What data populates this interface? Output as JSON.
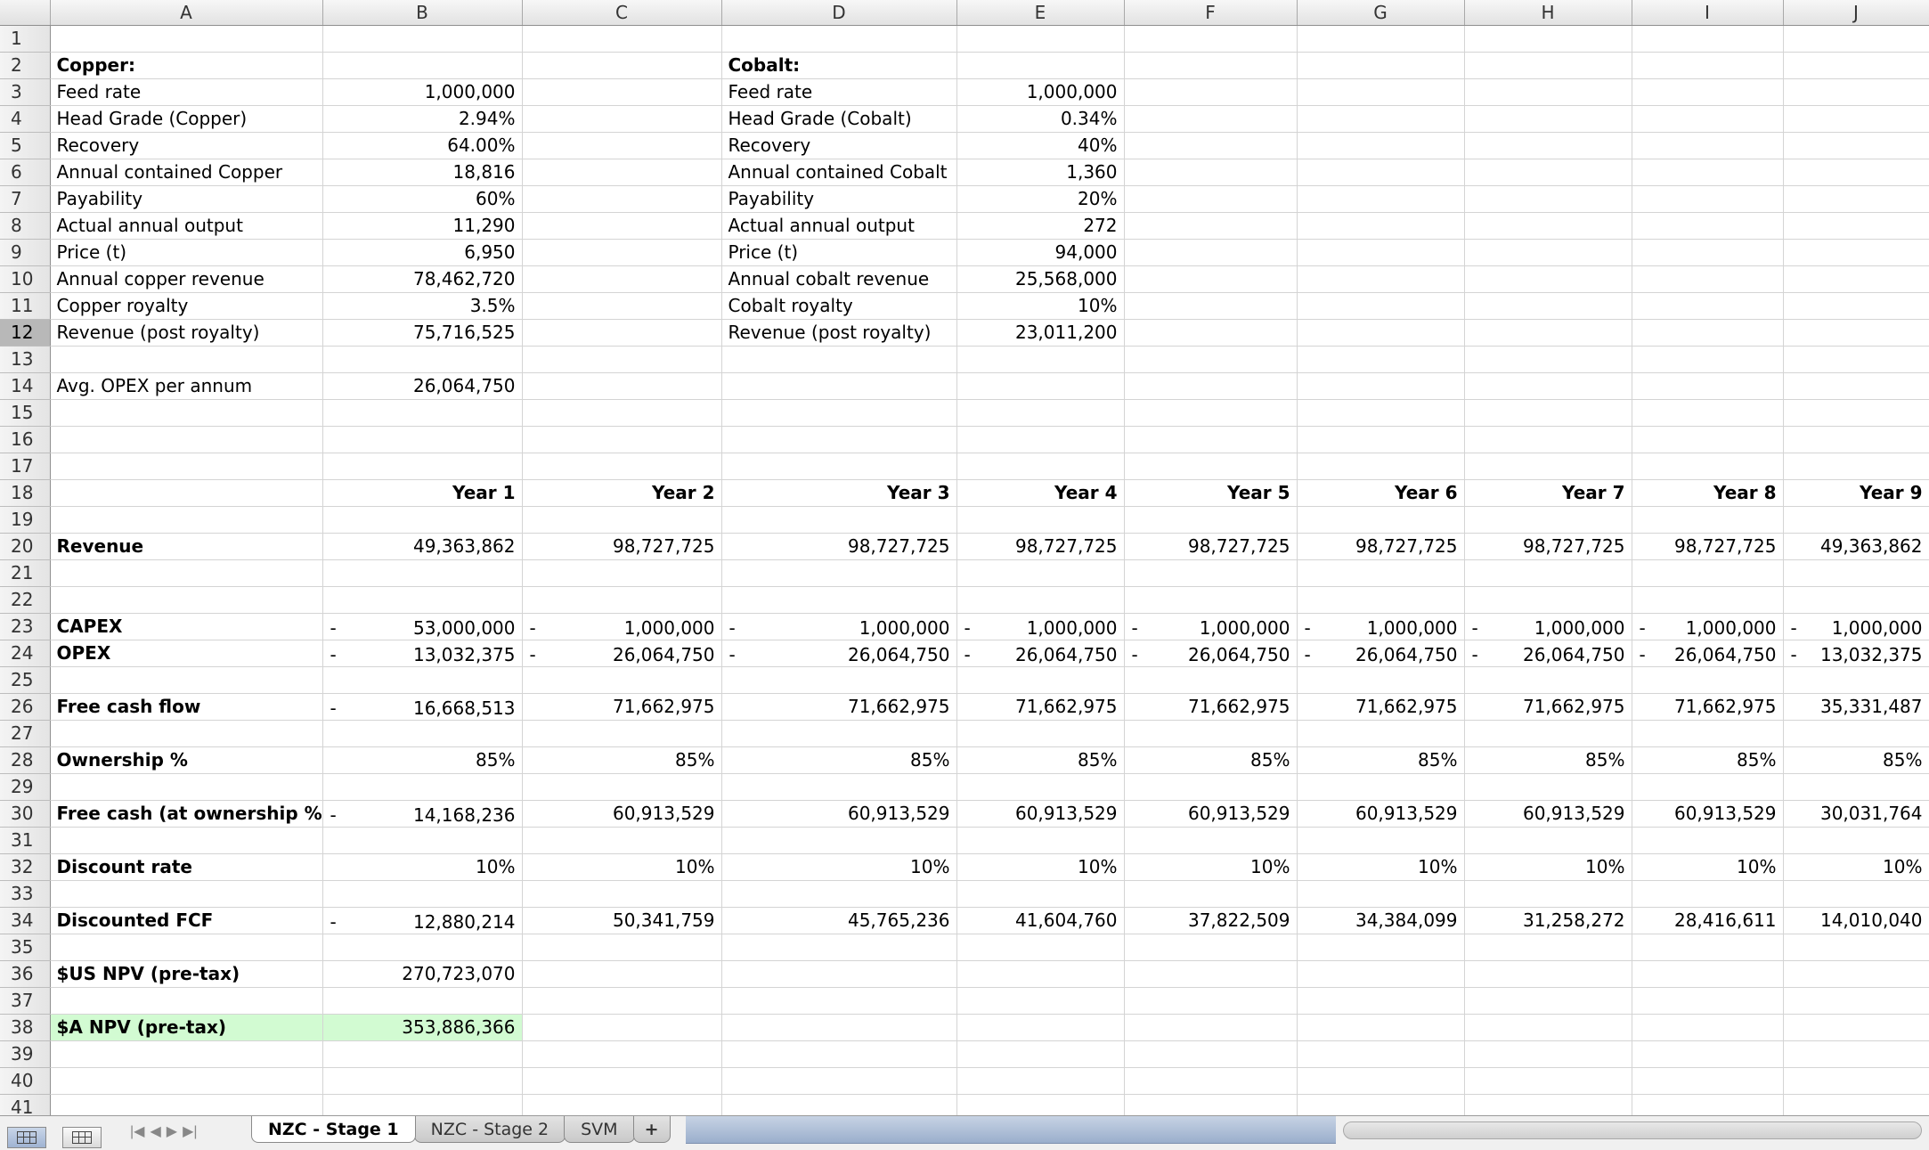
{
  "columns": [
    "A",
    "B",
    "C",
    "D",
    "E",
    "F",
    "G",
    "H",
    "I",
    "J"
  ],
  "selected_row": 12,
  "rows": [
    {
      "n": 1,
      "cells": []
    },
    {
      "n": 2,
      "cells": [
        {
          "c": 0,
          "v": "Copper:",
          "b": true
        },
        {
          "c": 3,
          "v": "Cobalt:",
          "b": true
        }
      ]
    },
    {
      "n": 3,
      "cells": [
        {
          "c": 0,
          "v": "Feed rate"
        },
        {
          "c": 1,
          "v": "1,000,000",
          "r": true
        },
        {
          "c": 3,
          "v": "Feed rate"
        },
        {
          "c": 4,
          "v": "1,000,000",
          "r": true
        }
      ]
    },
    {
      "n": 4,
      "cells": [
        {
          "c": 0,
          "v": "Head Grade (Copper)"
        },
        {
          "c": 1,
          "v": "2.94%",
          "r": true
        },
        {
          "c": 3,
          "v": "Head Grade (Cobalt)"
        },
        {
          "c": 4,
          "v": "0.34%",
          "r": true
        }
      ]
    },
    {
      "n": 5,
      "cells": [
        {
          "c": 0,
          "v": "Recovery"
        },
        {
          "c": 1,
          "v": "64.00%",
          "r": true
        },
        {
          "c": 3,
          "v": "Recovery"
        },
        {
          "c": 4,
          "v": "40%",
          "r": true
        }
      ]
    },
    {
      "n": 6,
      "cells": [
        {
          "c": 0,
          "v": "Annual contained Copper"
        },
        {
          "c": 1,
          "v": "18,816",
          "r": true
        },
        {
          "c": 3,
          "v": "Annual contained Cobalt"
        },
        {
          "c": 4,
          "v": "1,360",
          "r": true
        }
      ]
    },
    {
      "n": 7,
      "cells": [
        {
          "c": 0,
          "v": "Payability"
        },
        {
          "c": 1,
          "v": "60%",
          "r": true
        },
        {
          "c": 3,
          "v": "Payability"
        },
        {
          "c": 4,
          "v": "20%",
          "r": true
        }
      ]
    },
    {
      "n": 8,
      "cells": [
        {
          "c": 0,
          "v": "Actual annual output"
        },
        {
          "c": 1,
          "v": "11,290",
          "r": true
        },
        {
          "c": 3,
          "v": "Actual annual output"
        },
        {
          "c": 4,
          "v": "272",
          "r": true
        }
      ]
    },
    {
      "n": 9,
      "cells": [
        {
          "c": 0,
          "v": "Price (t)"
        },
        {
          "c": 1,
          "v": "6,950",
          "r": true
        },
        {
          "c": 3,
          "v": "Price (t)"
        },
        {
          "c": 4,
          "v": "94,000",
          "r": true
        }
      ]
    },
    {
      "n": 10,
      "cells": [
        {
          "c": 0,
          "v": "Annual copper revenue"
        },
        {
          "c": 1,
          "v": "78,462,720",
          "r": true
        },
        {
          "c": 3,
          "v": "Annual cobalt revenue"
        },
        {
          "c": 4,
          "v": "25,568,000",
          "r": true
        }
      ]
    },
    {
      "n": 11,
      "cells": [
        {
          "c": 0,
          "v": "Copper royalty"
        },
        {
          "c": 1,
          "v": "3.5%",
          "r": true
        },
        {
          "c": 3,
          "v": "Cobalt royalty"
        },
        {
          "c": 4,
          "v": "10%",
          "r": true
        }
      ]
    },
    {
      "n": 12,
      "cells": [
        {
          "c": 0,
          "v": "Revenue (post royalty)"
        },
        {
          "c": 1,
          "v": "75,716,525",
          "r": true
        },
        {
          "c": 3,
          "v": "Revenue (post royalty)"
        },
        {
          "c": 4,
          "v": "23,011,200",
          "r": true
        }
      ]
    },
    {
      "n": 13,
      "cells": []
    },
    {
      "n": 14,
      "cells": [
        {
          "c": 0,
          "v": "Avg. OPEX per annum"
        },
        {
          "c": 1,
          "v": "26,064,750",
          "r": true
        }
      ]
    },
    {
      "n": 15,
      "cells": []
    },
    {
      "n": 16,
      "cells": []
    },
    {
      "n": 17,
      "cells": []
    },
    {
      "n": 18,
      "cells": [
        {
          "c": 1,
          "v": "Year 1",
          "r": true,
          "b": true
        },
        {
          "c": 2,
          "v": "Year 2",
          "r": true,
          "b": true
        },
        {
          "c": 3,
          "v": "Year 3",
          "r": true,
          "b": true
        },
        {
          "c": 4,
          "v": "Year 4",
          "r": true,
          "b": true
        },
        {
          "c": 5,
          "v": "Year 5",
          "r": true,
          "b": true
        },
        {
          "c": 6,
          "v": "Year 6",
          "r": true,
          "b": true
        },
        {
          "c": 7,
          "v": "Year 7",
          "r": true,
          "b": true
        },
        {
          "c": 8,
          "v": "Year 8",
          "r": true,
          "b": true
        },
        {
          "c": 9,
          "v": "Year 9",
          "r": true,
          "b": true
        }
      ]
    },
    {
      "n": 19,
      "cells": []
    },
    {
      "n": 20,
      "cells": [
        {
          "c": 0,
          "v": "Revenue",
          "b": true
        },
        {
          "c": 1,
          "v": "49,363,862",
          "r": true
        },
        {
          "c": 2,
          "v": "98,727,725",
          "r": true
        },
        {
          "c": 3,
          "v": "98,727,725",
          "r": true
        },
        {
          "c": 4,
          "v": "98,727,725",
          "r": true
        },
        {
          "c": 5,
          "v": "98,727,725",
          "r": true
        },
        {
          "c": 6,
          "v": "98,727,725",
          "r": true
        },
        {
          "c": 7,
          "v": "98,727,725",
          "r": true
        },
        {
          "c": 8,
          "v": "98,727,725",
          "r": true
        },
        {
          "c": 9,
          "v": "49,363,862",
          "r": true
        }
      ]
    },
    {
      "n": 21,
      "cells": []
    },
    {
      "n": 22,
      "cells": []
    },
    {
      "n": 23,
      "cells": [
        {
          "c": 0,
          "v": "CAPEX",
          "b": true
        },
        {
          "c": 1,
          "v": "53,000,000",
          "r": true,
          "neg": true
        },
        {
          "c": 2,
          "v": "1,000,000",
          "r": true,
          "neg": true
        },
        {
          "c": 3,
          "v": "1,000,000",
          "r": true,
          "neg": true
        },
        {
          "c": 4,
          "v": "1,000,000",
          "r": true,
          "neg": true
        },
        {
          "c": 5,
          "v": "1,000,000",
          "r": true,
          "neg": true
        },
        {
          "c": 6,
          "v": "1,000,000",
          "r": true,
          "neg": true
        },
        {
          "c": 7,
          "v": "1,000,000",
          "r": true,
          "neg": true
        },
        {
          "c": 8,
          "v": "1,000,000",
          "r": true,
          "neg": true
        },
        {
          "c": 9,
          "v": "1,000,000",
          "r": true,
          "neg": true
        }
      ]
    },
    {
      "n": 24,
      "cells": [
        {
          "c": 0,
          "v": "OPEX",
          "b": true
        },
        {
          "c": 1,
          "v": "13,032,375",
          "r": true,
          "neg": true
        },
        {
          "c": 2,
          "v": "26,064,750",
          "r": true,
          "neg": true
        },
        {
          "c": 3,
          "v": "26,064,750",
          "r": true,
          "neg": true
        },
        {
          "c": 4,
          "v": "26,064,750",
          "r": true,
          "neg": true
        },
        {
          "c": 5,
          "v": "26,064,750",
          "r": true,
          "neg": true
        },
        {
          "c": 6,
          "v": "26,064,750",
          "r": true,
          "neg": true
        },
        {
          "c": 7,
          "v": "26,064,750",
          "r": true,
          "neg": true
        },
        {
          "c": 8,
          "v": "26,064,750",
          "r": true,
          "neg": true
        },
        {
          "c": 9,
          "v": "13,032,375",
          "r": true,
          "neg": true
        }
      ]
    },
    {
      "n": 25,
      "cells": []
    },
    {
      "n": 26,
      "cells": [
        {
          "c": 0,
          "v": "Free cash flow",
          "b": true
        },
        {
          "c": 1,
          "v": "16,668,513",
          "r": true,
          "neg": true
        },
        {
          "c": 2,
          "v": "71,662,975",
          "r": true
        },
        {
          "c": 3,
          "v": "71,662,975",
          "r": true
        },
        {
          "c": 4,
          "v": "71,662,975",
          "r": true
        },
        {
          "c": 5,
          "v": "71,662,975",
          "r": true
        },
        {
          "c": 6,
          "v": "71,662,975",
          "r": true
        },
        {
          "c": 7,
          "v": "71,662,975",
          "r": true
        },
        {
          "c": 8,
          "v": "71,662,975",
          "r": true
        },
        {
          "c": 9,
          "v": "35,331,487",
          "r": true
        }
      ]
    },
    {
      "n": 27,
      "cells": []
    },
    {
      "n": 28,
      "cells": [
        {
          "c": 0,
          "v": "Ownership %",
          "b": true
        },
        {
          "c": 1,
          "v": "85%",
          "r": true
        },
        {
          "c": 2,
          "v": "85%",
          "r": true
        },
        {
          "c": 3,
          "v": "85%",
          "r": true
        },
        {
          "c": 4,
          "v": "85%",
          "r": true
        },
        {
          "c": 5,
          "v": "85%",
          "r": true
        },
        {
          "c": 6,
          "v": "85%",
          "r": true
        },
        {
          "c": 7,
          "v": "85%",
          "r": true
        },
        {
          "c": 8,
          "v": "85%",
          "r": true
        },
        {
          "c": 9,
          "v": "85%",
          "r": true
        }
      ]
    },
    {
      "n": 29,
      "cells": []
    },
    {
      "n": 30,
      "cells": [
        {
          "c": 0,
          "v": "Free cash (at ownership %)",
          "b": true
        },
        {
          "c": 1,
          "v": "14,168,236",
          "r": true,
          "neg": true
        },
        {
          "c": 2,
          "v": "60,913,529",
          "r": true
        },
        {
          "c": 3,
          "v": "60,913,529",
          "r": true
        },
        {
          "c": 4,
          "v": "60,913,529",
          "r": true
        },
        {
          "c": 5,
          "v": "60,913,529",
          "r": true
        },
        {
          "c": 6,
          "v": "60,913,529",
          "r": true
        },
        {
          "c": 7,
          "v": "60,913,529",
          "r": true
        },
        {
          "c": 8,
          "v": "60,913,529",
          "r": true
        },
        {
          "c": 9,
          "v": "30,031,764",
          "r": true
        }
      ]
    },
    {
      "n": 31,
      "cells": []
    },
    {
      "n": 32,
      "cells": [
        {
          "c": 0,
          "v": "Discount rate",
          "b": true
        },
        {
          "c": 1,
          "v": "10%",
          "r": true
        },
        {
          "c": 2,
          "v": "10%",
          "r": true
        },
        {
          "c": 3,
          "v": "10%",
          "r": true
        },
        {
          "c": 4,
          "v": "10%",
          "r": true
        },
        {
          "c": 5,
          "v": "10%",
          "r": true
        },
        {
          "c": 6,
          "v": "10%",
          "r": true
        },
        {
          "c": 7,
          "v": "10%",
          "r": true
        },
        {
          "c": 8,
          "v": "10%",
          "r": true
        },
        {
          "c": 9,
          "v": "10%",
          "r": true
        }
      ]
    },
    {
      "n": 33,
      "cells": []
    },
    {
      "n": 34,
      "cells": [
        {
          "c": 0,
          "v": "Discounted FCF",
          "b": true
        },
        {
          "c": 1,
          "v": "12,880,214",
          "r": true,
          "neg": true
        },
        {
          "c": 2,
          "v": "50,341,759",
          "r": true
        },
        {
          "c": 3,
          "v": "45,765,236",
          "r": true
        },
        {
          "c": 4,
          "v": "41,604,760",
          "r": true
        },
        {
          "c": 5,
          "v": "37,822,509",
          "r": true
        },
        {
          "c": 6,
          "v": "34,384,099",
          "r": true
        },
        {
          "c": 7,
          "v": "31,258,272",
          "r": true
        },
        {
          "c": 8,
          "v": "28,416,611",
          "r": true
        },
        {
          "c": 9,
          "v": "14,010,040",
          "r": true
        }
      ]
    },
    {
      "n": 35,
      "cells": []
    },
    {
      "n": 36,
      "cells": [
        {
          "c": 0,
          "v": "$US  NPV (pre-tax)",
          "b": true
        },
        {
          "c": 1,
          "v": "270,723,070",
          "r": true
        }
      ]
    },
    {
      "n": 37,
      "cells": []
    },
    {
      "n": 38,
      "cells": [
        {
          "c": 0,
          "v": "$A   NPV (pre-tax)",
          "b": true,
          "hl": true
        },
        {
          "c": 1,
          "v": "353,886,366",
          "r": true,
          "hl": true
        }
      ]
    },
    {
      "n": 39,
      "cells": []
    },
    {
      "n": 40,
      "cells": []
    },
    {
      "n": 41,
      "cells": []
    }
  ],
  "neg_marker": "-",
  "highlight_color": "#d2fbd2",
  "sheet_tabs": [
    {
      "label": "NZC - Stage 1",
      "active": true
    },
    {
      "label": "NZC - Stage 2",
      "active": false
    },
    {
      "label": "SVM",
      "active": false
    }
  ],
  "add_sheet_label": "+",
  "nav_icons": [
    "first-sheet-icon",
    "prev-sheet-icon",
    "next-sheet-icon",
    "last-sheet-icon"
  ],
  "nav_glyphs": [
    "|◀",
    "◀",
    "▶",
    "▶|"
  ],
  "view_buttons": [
    "normal-view-icon",
    "page-layout-view-icon"
  ]
}
